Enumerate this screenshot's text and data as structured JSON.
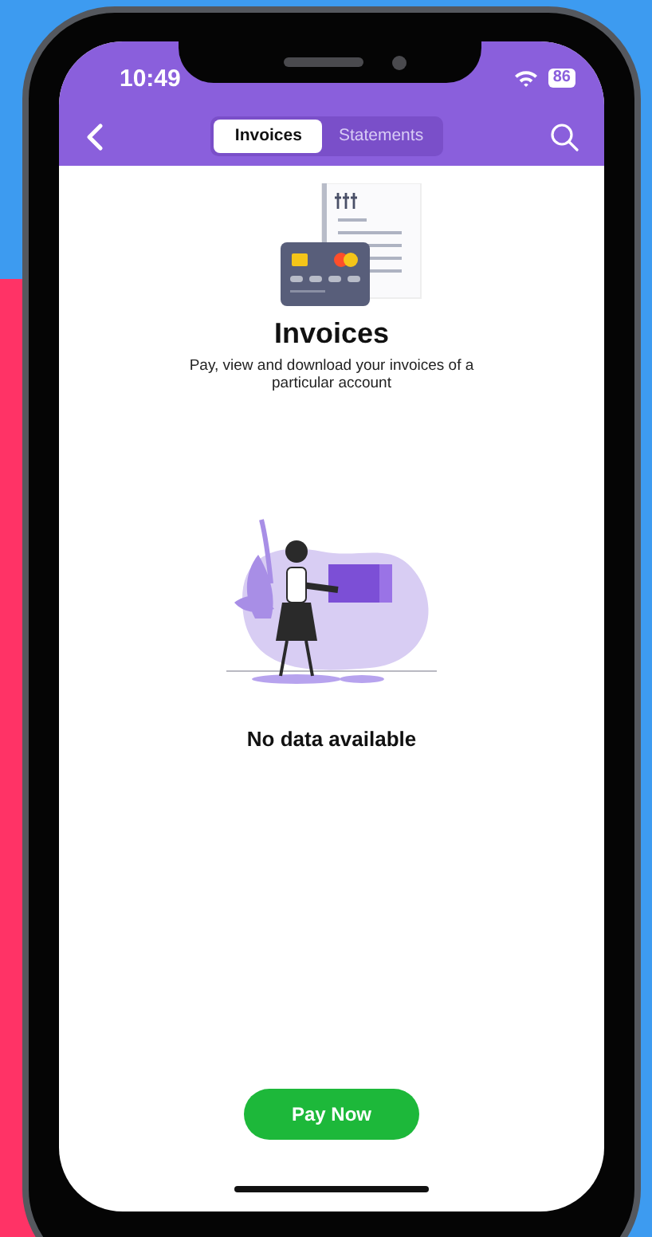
{
  "status_bar": {
    "time": "10:49",
    "battery": "86"
  },
  "header": {
    "tabs": [
      {
        "label": "Invoices",
        "selected": true
      },
      {
        "label": "Statements",
        "selected": false
      }
    ]
  },
  "hero": {
    "title": "Invoices",
    "description": "Pay, view and download your invoices of a particular account"
  },
  "empty_state": {
    "message": "No data available"
  },
  "primary_button": {
    "label": "Pay Now"
  }
}
